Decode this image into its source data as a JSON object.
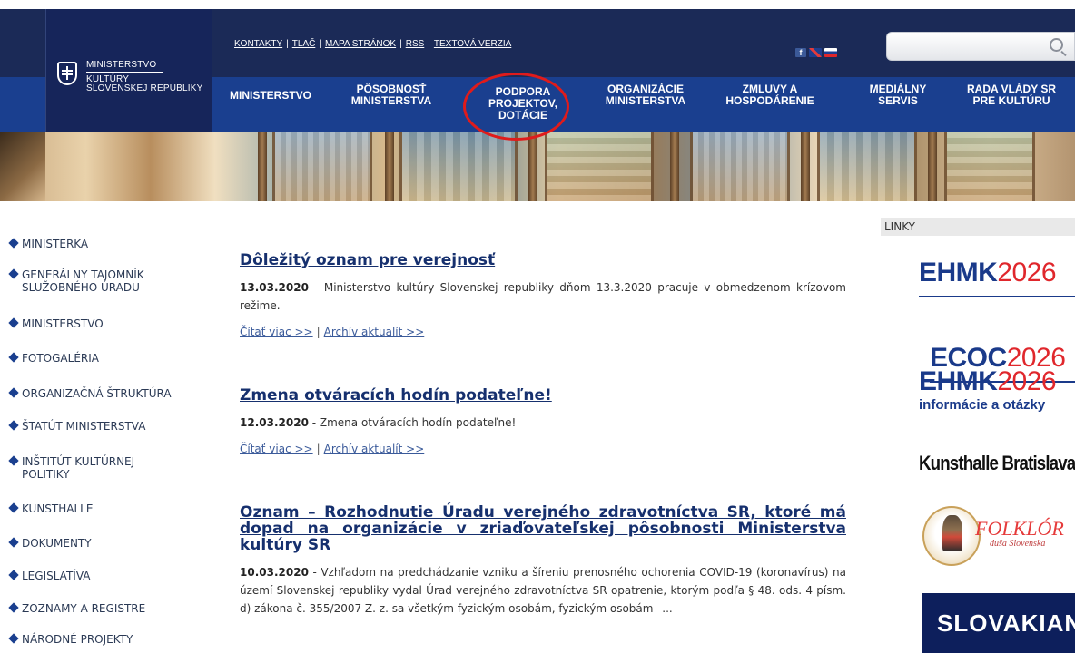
{
  "header": {
    "logo": {
      "line1": "MINISTERSTVO",
      "line2": "KULTÚRY",
      "line3": "SLOVENSKEJ REPUBLIKY"
    },
    "util_links": [
      "KONTAKTY",
      "TLAČ",
      "MAPA STRÁNOK",
      "RSS",
      "TEXTOVÁ VERZIA"
    ],
    "util_separator": "|",
    "social": {
      "facebook_label": "f"
    },
    "search": {
      "placeholder": "",
      "value": ""
    },
    "nav": [
      {
        "line1": "MINISTERSTVO",
        "line2": ""
      },
      {
        "line1": "PÔSOBNOSŤ",
        "line2": "MINISTERSTVA"
      },
      {
        "line1": "PODPORA",
        "line2": "PROJEKTOV,",
        "line3": "DOTÁCIE"
      },
      {
        "line1": "ORGANIZÁCIE",
        "line2": "MINISTERSTVA"
      },
      {
        "line1": "ZMLUVY A",
        "line2": "HOSPODÁRENIE"
      },
      {
        "line1": "MEDIÁLNY",
        "line2": "SERVIS"
      },
      {
        "line1": "RADA VLÁDY SR",
        "line2": "PRE KULTÚRU"
      }
    ],
    "highlight_color": "#e01b1b"
  },
  "sidebar": {
    "items": [
      {
        "line1": "MINISTERKA",
        "line2": ""
      },
      {
        "line1": "GENERÁLNY TAJOMNÍK",
        "line2": "SLUŽOBNÉHO ÚRADU"
      },
      {
        "line1": "MINISTERSTVO",
        "line2": ""
      },
      {
        "line1": "FOTOGALÉRIA",
        "line2": ""
      },
      {
        "line1": "ORGANIZAČNÁ ŠTRUKTÚRA",
        "line2": ""
      },
      {
        "line1": "ŠTATÚT MINISTERSTVA",
        "line2": ""
      },
      {
        "line1": "INŠTITÚT KULTÚRNEJ",
        "line2": "POLITIKY"
      },
      {
        "line1": "KUNSTHALLE",
        "line2": ""
      },
      {
        "line1": "DOKUMENTY",
        "line2": ""
      },
      {
        "line1": "LEGISLATÍVA",
        "line2": ""
      },
      {
        "line1": "ZOZNAMY A REGISTRE",
        "line2": ""
      },
      {
        "line1": "NÁRODNÉ PROJEKTY",
        "line2": ""
      }
    ]
  },
  "main": {
    "articles": [
      {
        "title": "Dôležitý oznam pre verejnosť",
        "date": "13.03.2020",
        "text": " - Ministerstvo kultúry Slovenskej republiky dňom 13.3.2020 pracuje v obmedzenom krízovom režime.",
        "more": "Čítať viac >>",
        "archive": "Archív aktualít >>"
      },
      {
        "title": "Zmena otváracích hodín podateľne!",
        "date": "12.03.2020",
        "text": " - Zmena otváracích hodín podateľne!",
        "more": "Čítať viac >>",
        "archive": "Archív aktualít >>"
      },
      {
        "title": "Oznam – Rozhodnutie Úradu verejného zdravotníctva SR, ktoré má dopad na organizácie v zriaďovateľskej pôsobnosti Ministerstva kultúry SR",
        "date": "10.03.2020",
        "text": " - Vzhľadom na predchádzanie vzniku a šíreniu prenosného ochorenia COVID-19 (koronavírus) na území Slovenskej republiky vydal Úrad verejného zdravotníctva SR opatrenie, ktorým podľa § 48. ods. 4 písm. d) zákona č. 355/2007 Z. z. sa všetkým fyzickým osobám, fyzickým osobám –..."
      }
    ],
    "link_separator": "|"
  },
  "right": {
    "links_title": "LINKY",
    "banners": [
      {
        "word": "EHMK",
        "year": "2026"
      },
      {
        "word": "ECOC",
        "year": "2026"
      },
      {
        "word": "EHMK",
        "year": "2026",
        "sub": "informácie a otázky"
      }
    ],
    "kunsthalle": "Kunsthalle Bratislava",
    "folklor": {
      "title": "FOLKLÓR",
      "sub": "duša Slovenska"
    },
    "slovakiana": "SLOVAKIANA",
    "colors": {
      "brand_blue": "#1a3a8a",
      "accent_red": "#e0272c"
    }
  }
}
